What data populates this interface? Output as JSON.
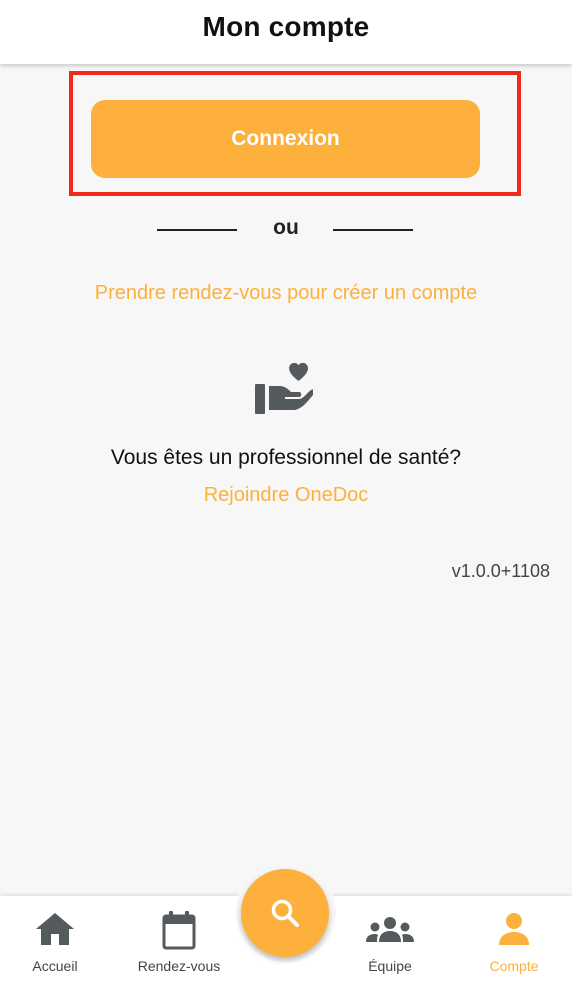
{
  "header": {
    "title": "Mon compte"
  },
  "auth": {
    "login_label": "Connexion",
    "divider_label": "ou",
    "create_account_link": "Prendre rendez-vous pour créer un compte"
  },
  "professional": {
    "icon": "hand-heart-icon",
    "question": "Vous êtes un professionnel de santé?",
    "join_link": "Rejoindre OneDoc"
  },
  "version": "v1.0.0+1108",
  "bottom_nav": {
    "items": [
      {
        "label": "Accueil",
        "icon": "home-icon",
        "active": false
      },
      {
        "label": "Rendez-vous",
        "icon": "calendar-icon",
        "active": false
      },
      {
        "label": "Équipe",
        "icon": "team-icon",
        "active": false
      },
      {
        "label": "Compte",
        "icon": "person-icon",
        "active": true
      }
    ],
    "fab_icon": "search-icon"
  },
  "colors": {
    "accent": "#fdb03c",
    "highlight_border": "#ee2a1a",
    "icon_gray": "#555a5c",
    "background": "#f7f7f7"
  }
}
